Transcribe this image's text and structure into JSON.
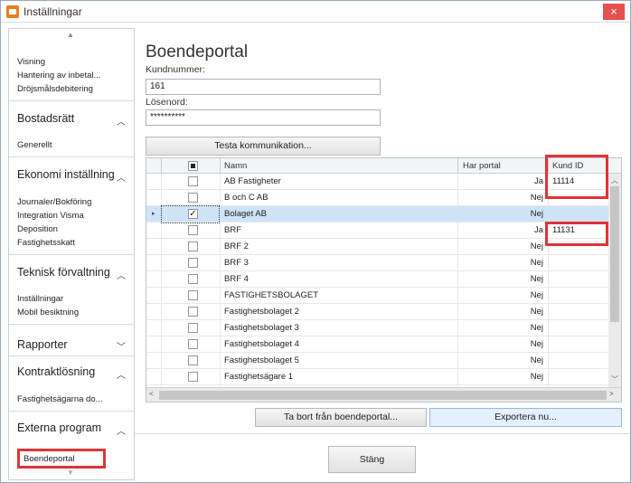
{
  "window": {
    "title": "Inställningar",
    "close": "×"
  },
  "sidebar": {
    "items_top": [
      "Visning",
      "Hantering av inbetal...",
      "Dröjsmålsdebitering"
    ],
    "sections": [
      {
        "header": "Bostadsrätt",
        "items": [
          "Generellt"
        ]
      },
      {
        "header": "Ekonomi inställning",
        "items": [
          "Journaler/Bokföring",
          "Integration Visma",
          "Deposition",
          "Fastighetsskatt"
        ]
      },
      {
        "header": "Teknisk förvaltning",
        "items": [
          "Inställningar",
          "Mobil besiktning"
        ]
      },
      {
        "header": "Rapporter",
        "items": []
      },
      {
        "header": "Kontraktlösning",
        "items": [
          "Fastighetsägarna do..."
        ]
      },
      {
        "header": "Externa program",
        "items": [
          "Boendeportal"
        ]
      }
    ]
  },
  "main": {
    "title": "Boendeportal",
    "kundnummer_label": "Kundnummer:",
    "kundnummer_value": "161",
    "losenord_label": "Lösenord:",
    "losenord_value": "**********",
    "test_button": "Testa kommunikation...",
    "remove_button": "Ta bort från boendeportal...",
    "export_button": "Exportera nu...",
    "close_button": "Stäng"
  },
  "grid": {
    "columns": [
      "Namn",
      "Har portal",
      "Kund ID"
    ],
    "rows": [
      {
        "name": "AB Fastigheter",
        "portal": "Ja",
        "kund_id": "11114",
        "checked": false
      },
      {
        "name": "B och C AB",
        "portal": "Nej",
        "kund_id": "",
        "checked": false
      },
      {
        "name": "Bolaget AB",
        "portal": "Nej",
        "kund_id": "",
        "checked": true
      },
      {
        "name": "BRF",
        "portal": "Ja",
        "kund_id": "11131",
        "checked": false
      },
      {
        "name": "BRF 2",
        "portal": "Nej",
        "kund_id": "",
        "checked": false
      },
      {
        "name": "BRF 3",
        "portal": "Nej",
        "kund_id": "",
        "checked": false
      },
      {
        "name": "BRF 4",
        "portal": "Nej",
        "kund_id": "",
        "checked": false
      },
      {
        "name": "FASTIGHETSBOLAGET",
        "portal": "Nej",
        "kund_id": "",
        "checked": false
      },
      {
        "name": "Fastighetsbolaget 2",
        "portal": "Nej",
        "kund_id": "",
        "checked": false
      },
      {
        "name": "Fastighetsbolaget 3",
        "portal": "Nej",
        "kund_id": "",
        "checked": false
      },
      {
        "name": "Fastighetsbolaget 4",
        "portal": "Nej",
        "kund_id": "",
        "checked": false
      },
      {
        "name": "Fastighetsbolaget 5",
        "portal": "Nej",
        "kund_id": "",
        "checked": false
      },
      {
        "name": "Fastighetsägare 1",
        "portal": "Nej",
        "kund_id": "",
        "checked": false
      }
    ],
    "selected_row": 2
  },
  "colors": {
    "highlight": "#e03434",
    "selection": "#cfe3f7",
    "close": "#e4514f"
  },
  "icons": {
    "app": "app-window-icon",
    "check": "✓",
    "collapse": "chevron-up-icon",
    "expand": "chevron-down-icon"
  }
}
